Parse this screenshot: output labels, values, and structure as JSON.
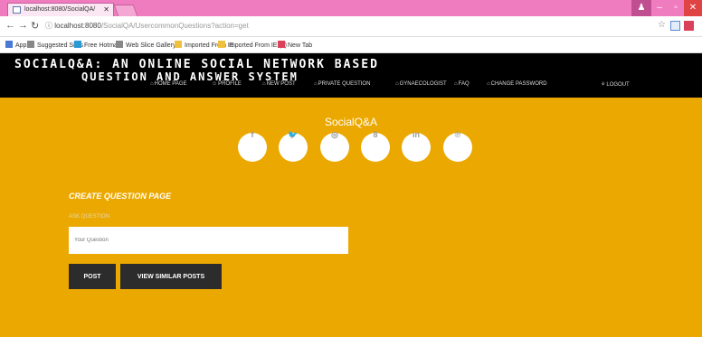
{
  "browser": {
    "tab_title": "localhost:8080/SocialQA/",
    "url_host": "localhost:8080",
    "url_path": "/SocialQA/UsercommonQuestions?action=get",
    "bookmarks": [
      {
        "label": "Apps",
        "icon": "apps-grid-icon",
        "color": "#4a7ad6"
      },
      {
        "label": "Suggested Sites",
        "icon": "page-icon",
        "color": "#888888"
      },
      {
        "label": "Free Hotmail",
        "icon": "windows-icon",
        "color": "#2a9ad6"
      },
      {
        "label": "Web Slice Gallery",
        "icon": "page-icon",
        "color": "#888888"
      },
      {
        "label": "Imported From IE",
        "icon": "folder-icon",
        "color": "#f0c040"
      },
      {
        "label": "Imported From IE (1)",
        "icon": "folder-icon",
        "color": "#f0c040"
      },
      {
        "label": "New Tab",
        "icon": "newtab-icon",
        "color": "#d9425a"
      }
    ]
  },
  "header": {
    "brand_line1": "SOCIALQ&A: AN ONLINE SOCIAL NETWORK BASED",
    "brand_line2": "QUESTION AND ANSWER SYSTEM",
    "nav": [
      {
        "label": "HOME PAGE",
        "icon": "home-icon",
        "glyph": "⌂"
      },
      {
        "label": "PROFILE",
        "icon": "profile-icon",
        "glyph": "☺"
      },
      {
        "label": "NEW POST",
        "icon": "home-icon",
        "glyph": "⌂"
      },
      {
        "label": "PRIVATE QUESTION",
        "icon": "home-icon",
        "glyph": "⌂"
      },
      {
        "label": "GYNAECOLOGIST",
        "icon": "home-icon",
        "glyph": "⌂"
      },
      {
        "label": "FAQ",
        "icon": "home-icon",
        "glyph": "⌂"
      },
      {
        "label": "CHANGE PASSWORD",
        "icon": "home-icon",
        "glyph": "⌂"
      },
      {
        "label": "LOGOUT",
        "icon": "logout-icon",
        "glyph": "⚘"
      }
    ]
  },
  "hero": {
    "title": "SocialQ&A",
    "social": [
      {
        "name": "facebook-icon",
        "glyph": "f"
      },
      {
        "name": "twitter-icon",
        "glyph": "🐦"
      },
      {
        "name": "dribbble-icon",
        "glyph": "◎"
      },
      {
        "name": "google-plus-icon",
        "glyph": "8"
      },
      {
        "name": "linkedin-icon",
        "glyph": "in"
      },
      {
        "name": "pinterest-icon",
        "glyph": "℗"
      }
    ]
  },
  "form": {
    "heading": "CREATE QUESTION PAGE",
    "ask_label": "ASK QUESTION",
    "question_placeholder": "Your Question",
    "post_label": "POST",
    "similar_label": "VIEW SIMILAR POSTS"
  },
  "colors": {
    "background": "#eba800",
    "header": "#000000",
    "button": "#2c2c2c",
    "chrome": "#f07cc0"
  }
}
